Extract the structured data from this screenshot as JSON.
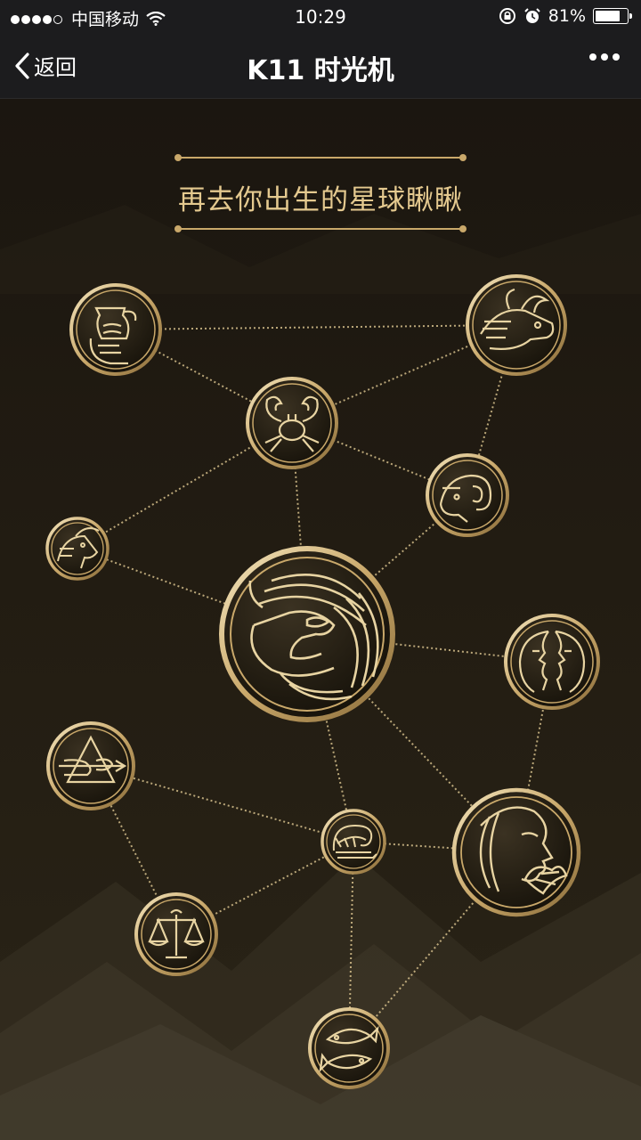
{
  "status": {
    "carrier": "中国移动",
    "time": "10:29",
    "battery_percent": "81%",
    "battery_level": 0.81
  },
  "nav": {
    "back_label": "返回",
    "title": "K11 时光机"
  },
  "content": {
    "headline": "再去你出生的星球瞅瞅"
  },
  "colors": {
    "gold": "#c9a86a",
    "gold_light": "#f2e3bb",
    "background": "#1d1810"
  },
  "medals": [
    {
      "id": "aquarius",
      "icon": "aquarius-icon"
    },
    {
      "id": "taurus",
      "icon": "taurus-icon"
    },
    {
      "id": "cancer",
      "icon": "cancer-icon"
    },
    {
      "id": "aries",
      "icon": "aries-icon"
    },
    {
      "id": "capricorn",
      "icon": "capricorn-icon"
    },
    {
      "id": "leo",
      "icon": "leo-icon"
    },
    {
      "id": "gemini",
      "icon": "gemini-icon"
    },
    {
      "id": "sagittarius",
      "icon": "sagittarius-icon"
    },
    {
      "id": "scorpio",
      "icon": "scorpio-icon"
    },
    {
      "id": "virgo",
      "icon": "virgo-icon"
    },
    {
      "id": "libra",
      "icon": "libra-icon"
    },
    {
      "id": "pisces",
      "icon": "pisces-icon"
    }
  ]
}
